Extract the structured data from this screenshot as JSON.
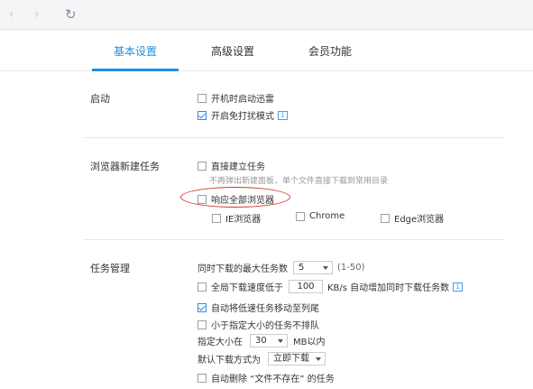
{
  "nav": {
    "back_glyph": "‹",
    "forward_glyph": "›",
    "refresh_glyph": "↻"
  },
  "tabs": [
    {
      "label": "基本设置",
      "active": true
    },
    {
      "label": "高级设置",
      "active": false
    },
    {
      "label": "会员功能",
      "active": false
    }
  ],
  "startup": {
    "label": "启动",
    "options": [
      {
        "label": "开机时启动迅雷",
        "checked": false
      },
      {
        "label": "开启免打扰模式",
        "checked": true
      }
    ],
    "info_glyph": "i"
  },
  "browser_task": {
    "label": "浏览器新建任务",
    "direct_create": {
      "label": "直接建立任务",
      "checked": false
    },
    "hint": "不再弹出新建面板，单个文件直接下载到常用目录",
    "respond_all": {
      "label": "响应全部浏览器",
      "checked": false
    },
    "browsers": [
      {
        "label": "IE浏览器",
        "checked": false
      },
      {
        "label": "Chrome",
        "checked": false
      },
      {
        "label": "Edge浏览器",
        "checked": false
      }
    ]
  },
  "task_mgmt": {
    "label": "任务管理",
    "max_tasks_label": "同时下载的最大任务数",
    "max_tasks_value": "5",
    "max_tasks_range": "(1-50)",
    "speed_rule": {
      "prefix": "全局下载速度低于",
      "value": "100",
      "suffix": "KB/s 自动增加同时下载任务数",
      "checked": false
    },
    "move_slow": {
      "label": "自动将低速任务移动至列尾",
      "checked": true
    },
    "small_first": {
      "label": "小于指定大小的任务不排队",
      "checked": false
    },
    "size_label": "指定大小在",
    "size_value": "30",
    "size_unit": "MB以内",
    "download_mode_label": "默认下载方式为",
    "download_mode_value": "立即下载",
    "auto_delete": {
      "label": "自动删除 “文件不存在” 的任务",
      "checked": false
    }
  },
  "colors": {
    "accent": "#1e8fe0",
    "annotation": "#d9342b"
  }
}
